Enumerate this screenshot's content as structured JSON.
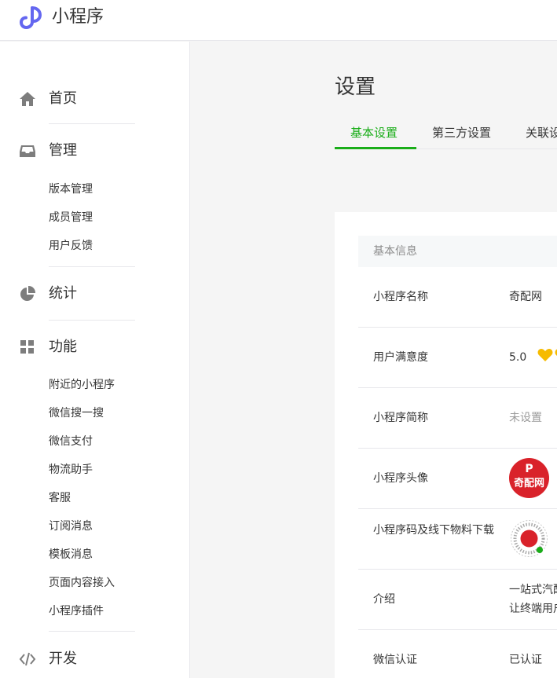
{
  "header": {
    "app_title": "小程序",
    "logo_icon": "miniprogram-logo-icon",
    "brand_color": "#6467f0"
  },
  "sidebar": {
    "groups": [
      {
        "label": "首页",
        "icon": "home-icon"
      },
      {
        "label": "管理",
        "icon": "inbox-icon",
        "items": [
          "版本管理",
          "成员管理",
          "用户反馈"
        ]
      },
      {
        "label": "统计",
        "icon": "pie-chart-icon"
      },
      {
        "label": "功能",
        "icon": "grid-icon",
        "items": [
          "附近的小程序",
          "微信搜一搜",
          "微信支付",
          "物流助手",
          "客服",
          "订阅消息",
          "模板消息",
          "页面内容接入",
          "小程序插件"
        ]
      },
      {
        "label": "开发",
        "icon": "code-icon"
      }
    ]
  },
  "main": {
    "title": "设置",
    "tabs": [
      {
        "label": "基本设置",
        "active": true
      },
      {
        "label": "第三方设置",
        "active": false
      },
      {
        "label": "关联设",
        "active": false
      }
    ],
    "accent_color": "#1aad19",
    "section_title": "基本信息",
    "rows": [
      {
        "key": "小程序名称",
        "value": "奇配网"
      },
      {
        "key": "用户满意度",
        "value": "5.0",
        "rating": 5
      },
      {
        "key": "小程序简称",
        "value": "未设置"
      },
      {
        "key": "小程序头像",
        "avatar_text": "奇配网",
        "avatar_letter": "P"
      },
      {
        "key": "小程序码及线下物料下载",
        "qrcode": "qrcode-icon"
      },
      {
        "key": "介绍",
        "value_line1": "一站式汽配",
        "value_line2": "让终端用户"
      },
      {
        "key": "微信认证",
        "value": "已认证"
      }
    ]
  }
}
